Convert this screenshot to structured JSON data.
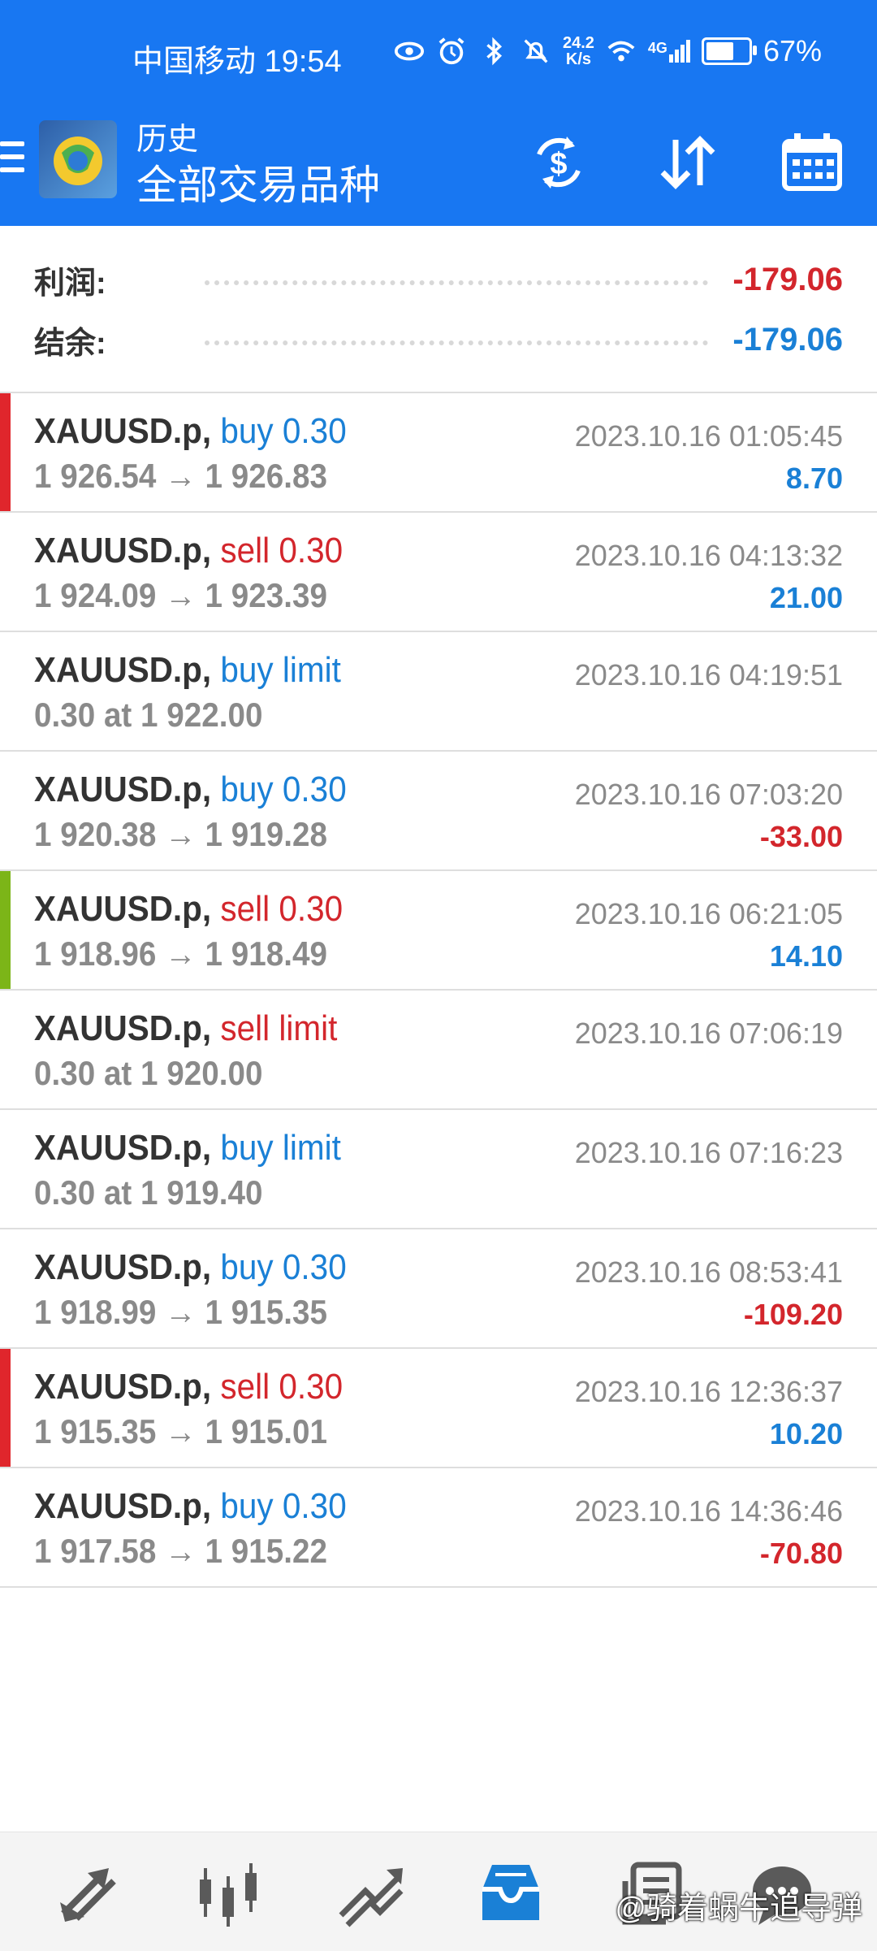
{
  "status_bar": {
    "carrier_time": "中国移动 19:54",
    "net_speed_value": "24.2",
    "net_speed_unit": "K/s",
    "network_label": "4G",
    "battery": "67%",
    "battery_level": 0.67
  },
  "app_bar": {
    "title": "历史",
    "subtitle": "全部交易品种",
    "icons": [
      "menu-icon",
      "app-logo",
      "currency-swap-icon",
      "sort-icon",
      "calendar-icon"
    ]
  },
  "summary": {
    "profit_label": "利润:",
    "profit_value": "-179.06",
    "balance_label": "结余:",
    "balance_value": "-179.06"
  },
  "colors": {
    "header_blue": "#1877f2",
    "buy_blue": "#1a80d6",
    "sell_red": "#d3262c",
    "marker_red": "#e0262c",
    "marker_green": "#7cb518"
  },
  "deals": [
    {
      "symbol": "XAUUSD.p,",
      "type": "buy 0.30",
      "type_color": "blue",
      "prices": "1 926.54 → 1 926.83",
      "time": "2023.10.16 01:05:45",
      "profit": "8.70",
      "profit_color": "blue",
      "marker": "red"
    },
    {
      "symbol": "XAUUSD.p,",
      "type": "sell 0.30",
      "type_color": "red",
      "prices": "1 924.09 → 1 923.39",
      "time": "2023.10.16 04:13:32",
      "profit": "21.00",
      "profit_color": "blue",
      "marker": ""
    },
    {
      "symbol": "XAUUSD.p,",
      "type": "buy limit",
      "type_color": "blue",
      "prices": "0.30 at 1 922.00",
      "time": "2023.10.16 04:19:51",
      "profit": "",
      "profit_color": "blue",
      "marker": ""
    },
    {
      "symbol": "XAUUSD.p,",
      "type": "buy 0.30",
      "type_color": "blue",
      "prices": "1 920.38 → 1 919.28",
      "time": "2023.10.16 07:03:20",
      "profit": "-33.00",
      "profit_color": "red",
      "marker": ""
    },
    {
      "symbol": "XAUUSD.p,",
      "type": "sell 0.30",
      "type_color": "red",
      "prices": "1 918.96 → 1 918.49",
      "time": "2023.10.16 06:21:05",
      "profit": "14.10",
      "profit_color": "blue",
      "marker": "green"
    },
    {
      "symbol": "XAUUSD.p,",
      "type": "sell limit",
      "type_color": "red",
      "prices": "0.30 at 1 920.00",
      "time": "2023.10.16 07:06:19",
      "profit": "",
      "profit_color": "blue",
      "marker": ""
    },
    {
      "symbol": "XAUUSD.p,",
      "type": "buy limit",
      "type_color": "blue",
      "prices": "0.30 at 1 919.40",
      "time": "2023.10.16 07:16:23",
      "profit": "",
      "profit_color": "blue",
      "marker": ""
    },
    {
      "symbol": "XAUUSD.p,",
      "type": "buy 0.30",
      "type_color": "blue",
      "prices": "1 918.99 → 1 915.35",
      "time": "2023.10.16 08:53:41",
      "profit": "-109.20",
      "profit_color": "red",
      "marker": ""
    },
    {
      "symbol": "XAUUSD.p,",
      "type": "sell 0.30",
      "type_color": "red",
      "prices": "1 915.35 → 1 915.01",
      "time": "2023.10.16 12:36:37",
      "profit": "10.20",
      "profit_color": "blue",
      "marker": "red"
    },
    {
      "symbol": "XAUUSD.p,",
      "type": "buy 0.30",
      "type_color": "blue",
      "prices": "1 917.58 → 1 915.22",
      "time": "2023.10.16 14:36:46",
      "profit": "-70.80",
      "profit_color": "red",
      "marker": ""
    }
  ],
  "bottom_nav": {
    "items": [
      "quotes-icon",
      "chart-icon",
      "trade-icon",
      "history-icon",
      "news-icon",
      "chat-icon"
    ],
    "active": "history-icon",
    "watermark": "@骑着蜗牛追导弹"
  }
}
